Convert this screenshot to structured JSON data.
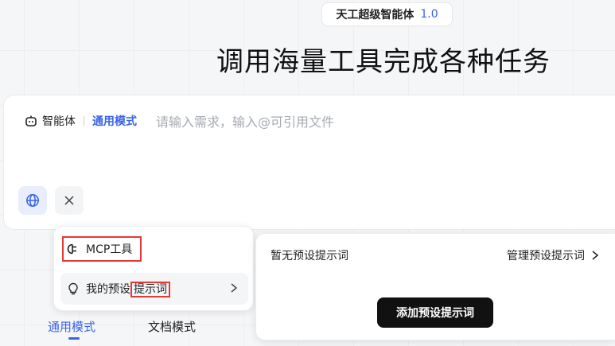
{
  "header": {
    "badge_name": "天工超级智能体",
    "badge_version": "1.0",
    "title": "调用海量工具完成各种任务"
  },
  "input": {
    "agent_label": "智能体",
    "mode_label": "通用模式",
    "placeholder": "请输入需求，输入@可引用文件",
    "globe_icon": "globe-icon",
    "close_icon": "close-icon"
  },
  "tool_menu": {
    "mcp_label": "MCP工具",
    "prompt_label_prefix": "我的预设",
    "prompt_label_highlight": "提示词"
  },
  "prompt_panel": {
    "empty_text": "暂无预设提示词",
    "manage_label": "管理预设提示词",
    "add_button": "添加预设提示词"
  },
  "bottom_tabs": [
    {
      "label": "通用模式",
      "active": true
    },
    {
      "label": "文档模式",
      "active": false
    }
  ],
  "colors": {
    "accent": "#3a63e6",
    "highlight_border": "#e53935",
    "primary_button": "#111111"
  }
}
